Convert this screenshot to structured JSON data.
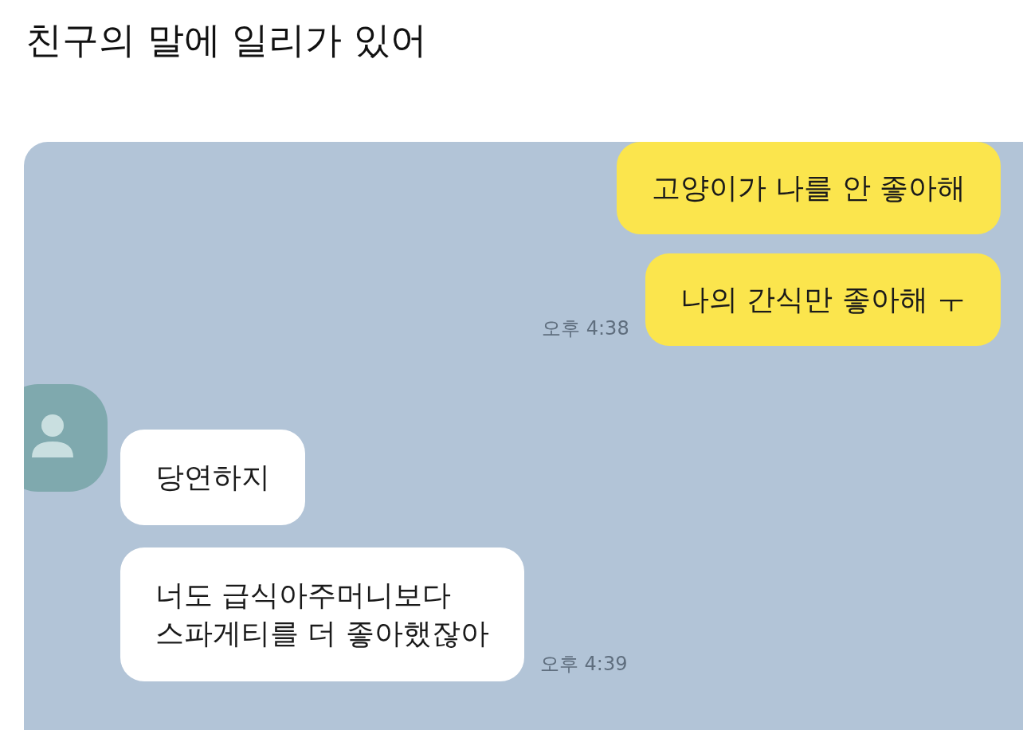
{
  "title": "친구의 말에 일리가 있어",
  "messages": [
    {
      "kind": "sent",
      "bubbles": [
        "고양이가 나를 안 좋아해",
        "나의 간식만 좋아해 ㅜ"
      ],
      "time": "오후 4:38"
    },
    {
      "kind": "received",
      "bubbles": [
        "당연하지",
        "너도 급식아주머니보다\n스파게티를 더 좋아했잖아"
      ],
      "time": "오후 4:39"
    }
  ]
}
